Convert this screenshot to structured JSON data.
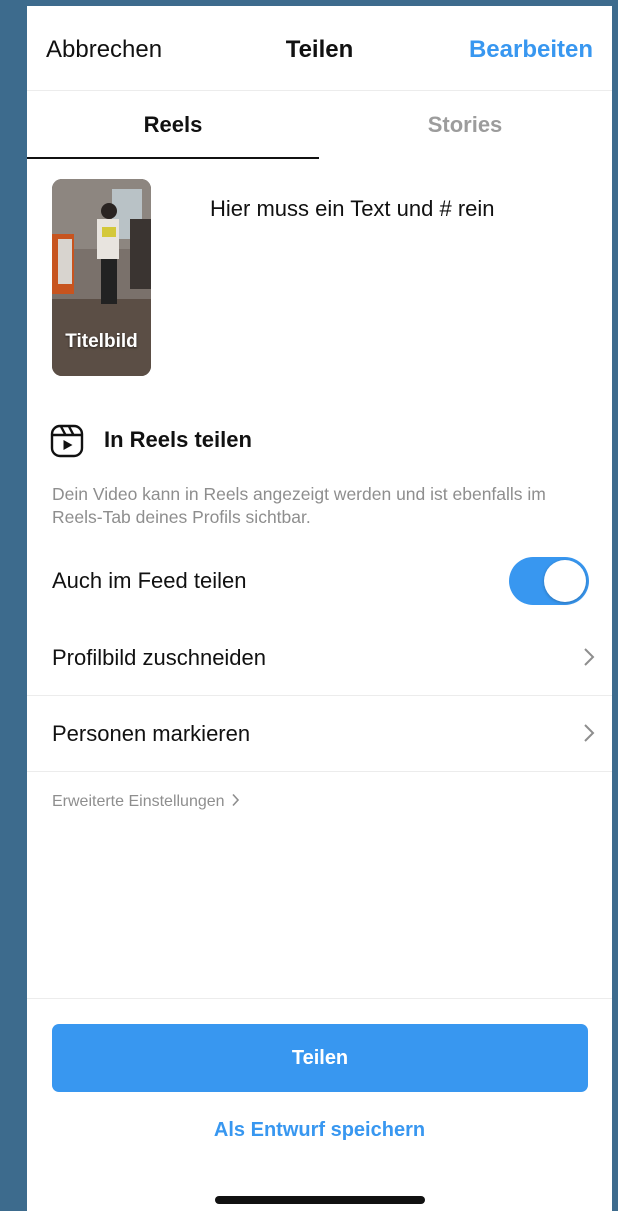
{
  "header": {
    "cancel": "Abbrechen",
    "title": "Teilen",
    "edit": "Bearbeiten"
  },
  "tabs": [
    {
      "label": "Reels",
      "active": true
    },
    {
      "label": "Stories",
      "active": false
    }
  ],
  "media": {
    "thumbnail_label": "Titelbild",
    "caption": "Hier muss ein Text und # rein"
  },
  "reels_section": {
    "icon": "reels-icon",
    "title": "In Reels teilen",
    "description": "Dein Video kann in Reels angezeigt werden und ist ebenfalls im Reels-Tab deines Profils sichtbar."
  },
  "feed_toggle": {
    "label": "Auch im Feed teilen",
    "on": true
  },
  "rows": [
    {
      "label": "Profilbild zuschneiden",
      "icon": "chevron-right-icon"
    },
    {
      "label": "Personen markieren",
      "icon": "chevron-right-icon"
    }
  ],
  "advanced_settings": "Erweiterte Einstellungen",
  "footer": {
    "share": "Teilen",
    "save_draft": "Als Entwurf speichern"
  },
  "colors": {
    "accent": "#3897f0",
    "text": "#111111",
    "secondary_text": "#8e8e8e",
    "divider": "#ececec",
    "backdrop": "#3d6b8d"
  }
}
